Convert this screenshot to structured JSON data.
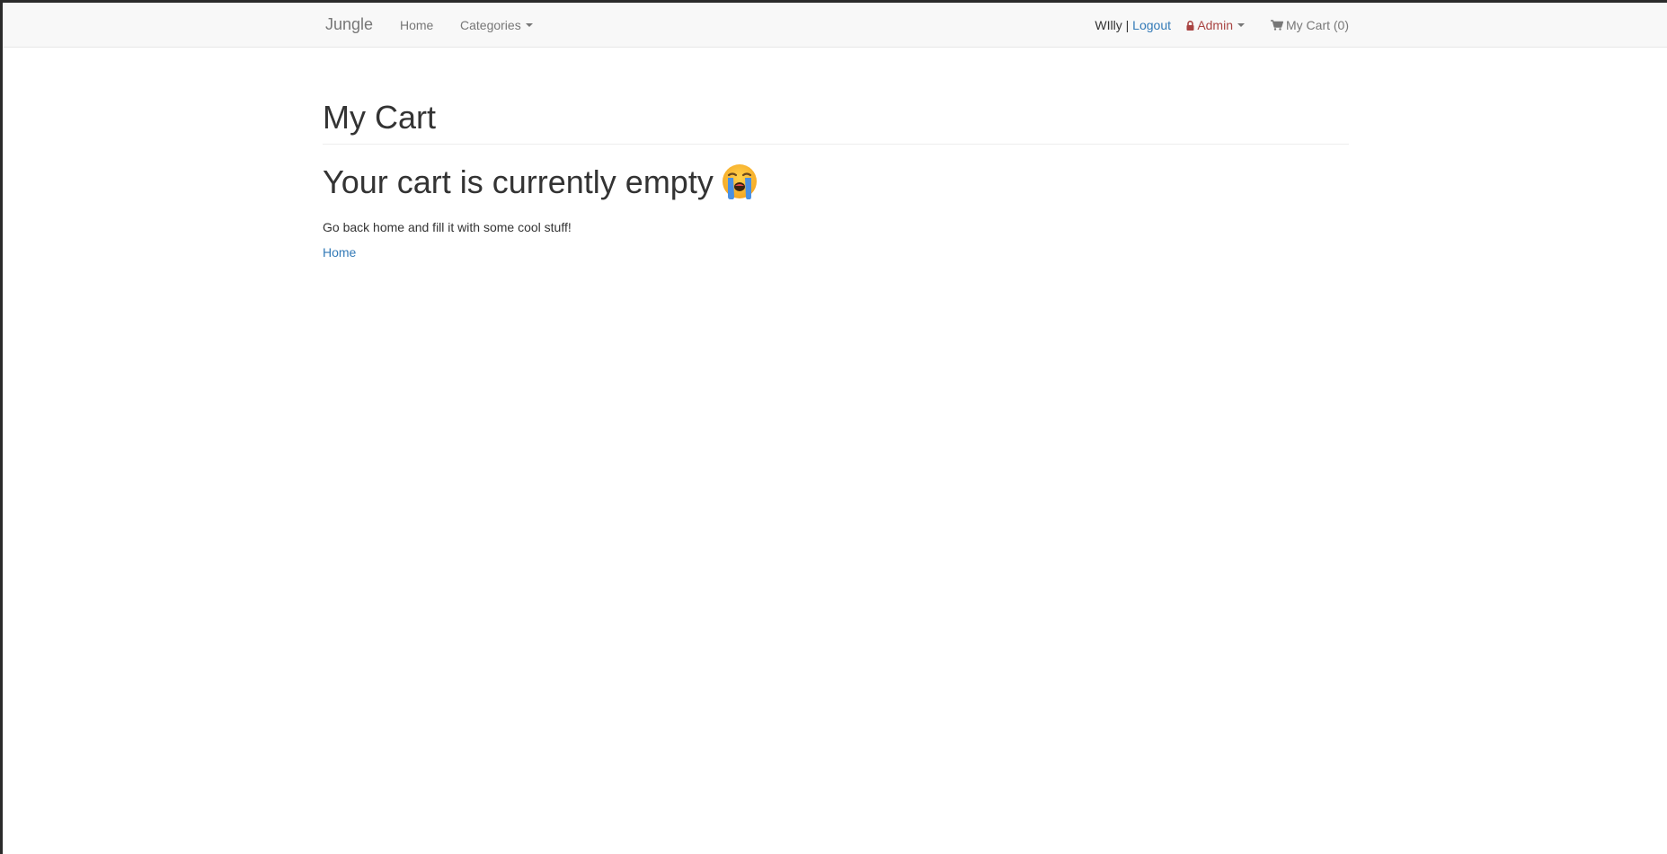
{
  "navbar": {
    "brand": "Jungle",
    "home": "Home",
    "categories": "Categories",
    "user_name": "WIlly",
    "separator": "|",
    "logout": "Logout",
    "admin": "Admin",
    "cart": "My Cart (0)"
  },
  "main": {
    "title": "My Cart",
    "empty_heading": "Your cart is currently empty",
    "empty_emoji": "loudly-crying-face-icon",
    "message": "Go back home and fill it with some cool stuff!",
    "home_link": "Home"
  },
  "colors": {
    "link": "#337ab7",
    "admin": "#a94442",
    "navbar_bg": "#f8f8f8",
    "text": "#333333"
  }
}
